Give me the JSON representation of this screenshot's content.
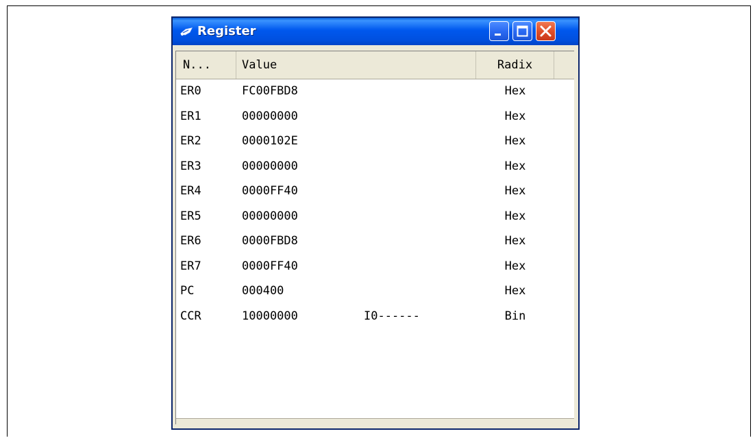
{
  "window": {
    "title": "Register"
  },
  "table": {
    "columns": {
      "name": "N...",
      "value": "Value",
      "radix": "Radix"
    },
    "rows": [
      {
        "name": "ER0",
        "value": "FC00FBD8",
        "flags": "",
        "radix": "Hex"
      },
      {
        "name": "ER1",
        "value": "00000000",
        "flags": "",
        "radix": "Hex"
      },
      {
        "name": "ER2",
        "value": "0000102E",
        "flags": "",
        "radix": "Hex"
      },
      {
        "name": "ER3",
        "value": "00000000",
        "flags": "",
        "radix": "Hex"
      },
      {
        "name": "ER4",
        "value": "0000FF40",
        "flags": "",
        "radix": "Hex"
      },
      {
        "name": "ER5",
        "value": "00000000",
        "flags": "",
        "radix": "Hex"
      },
      {
        "name": "ER6",
        "value": "0000FBD8",
        "flags": "",
        "radix": "Hex"
      },
      {
        "name": "ER7",
        "value": "0000FF40",
        "flags": "",
        "radix": "Hex"
      },
      {
        "name": "PC",
        "value": "000400",
        "flags": "",
        "radix": "Hex"
      },
      {
        "name": "CCR",
        "value": "10000000",
        "flags": "I0------",
        "radix": "Bin"
      }
    ]
  },
  "icons": {
    "title": "register-window-icon",
    "minimize": "minimize-icon",
    "maximize": "maximize-icon",
    "close": "close-icon"
  }
}
